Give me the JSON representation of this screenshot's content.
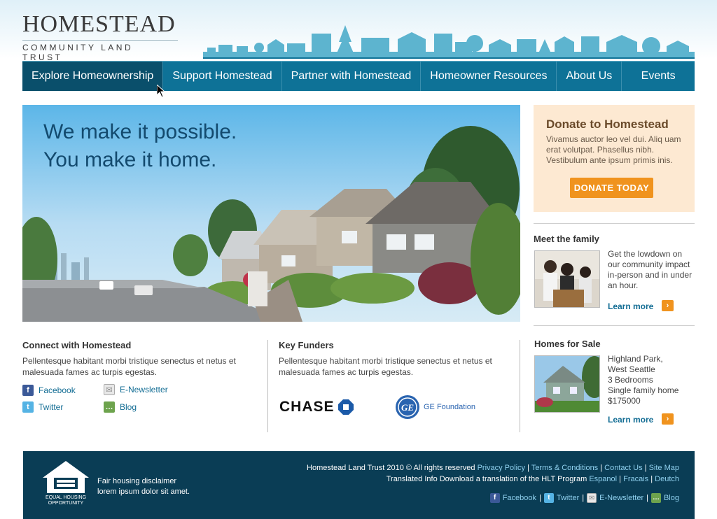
{
  "brand": {
    "title": "Homestead",
    "subtitle": "Community Land Trust"
  },
  "nav": {
    "items": [
      {
        "label": "Explore Homeownership"
      },
      {
        "label": "Support Homestead"
      },
      {
        "label": "Partner with Homestead"
      },
      {
        "label": "Homeowner Resources"
      },
      {
        "label": "About Us"
      },
      {
        "label": "Events"
      }
    ]
  },
  "hero": {
    "line1": "We make it possible.",
    "line2": "You make it home."
  },
  "donate": {
    "title": "Donate to Homestead",
    "text": "Vivamus auctor leo vel dui. Aliq uam erat volutpat. Phasellus nibh. Vestibulum ante ipsum primis inis.",
    "button": "DONATE TODAY"
  },
  "family": {
    "title": "Meet the family",
    "text": "Get the lowdown on our community impact in-person and in under an hour.",
    "learn": "Learn more"
  },
  "homes": {
    "title": "Homes for Sale",
    "lines": [
      "Highland Park,",
      "West Seattle",
      "3 Bedrooms",
      "Single family home",
      "$175000"
    ],
    "learn": "Learn more"
  },
  "connect": {
    "title": "Connect with Homestead",
    "text": "Pellentesque habitant morbi tristique senectus et netus et malesuada fames ac turpis egestas.",
    "links": {
      "facebook": "Facebook",
      "twitter": "Twitter",
      "enews": "E-Newsletter",
      "blog": "Blog"
    }
  },
  "funders": {
    "title": "Key Funders",
    "text": "Pellentesque habitant morbi tristique senectus et netus et malesuada fames ac turpis egestas.",
    "chase": "CHASE",
    "ge_mark": "GE",
    "ge_label": "GE Foundation"
  },
  "footer": {
    "eho": "EQUAL HOUSING OPPORTUNITY",
    "disclaimer1": "Fair housing disclaimer",
    "disclaimer2": "lorem ipsum dolor sit amet.",
    "copyright": "Homestead Land Trust 2010 © All rights reserved",
    "links": [
      "Privacy Policy",
      "Terms & Conditions",
      "Contact Us",
      "Site Map"
    ],
    "sep": "|",
    "translate_text": "Translated Info Download a translation of the HLT Program",
    "languages": [
      "Espanol",
      "Fracais",
      "Deutch"
    ],
    "social": {
      "facebook": "Facebook",
      "twitter": "Twitter",
      "enews": "E-Newsletter",
      "blog": "Blog"
    }
  },
  "colors": {
    "nav": "#0e7297",
    "nav_active": "#0a4f6b",
    "accent": "#f0931e",
    "footer": "#0a3d55"
  }
}
